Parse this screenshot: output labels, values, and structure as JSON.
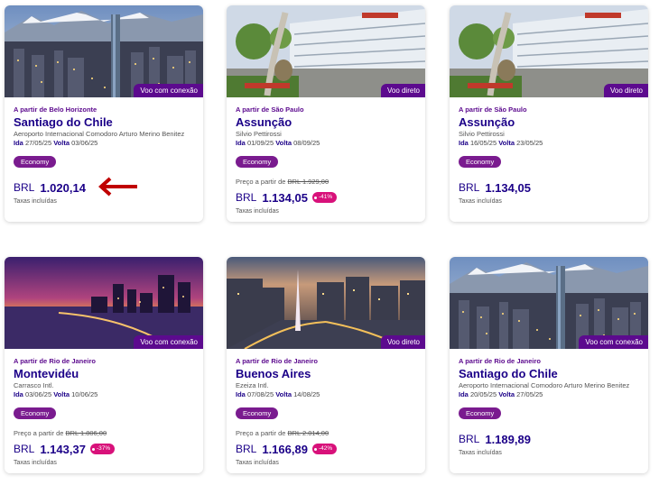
{
  "colors": {
    "primary": "#1b0088",
    "badge": "#5c0a8e",
    "fare": "#7a1b8f",
    "discount": "#d8117a",
    "arrow": "#c00000"
  },
  "labels": {
    "from_price": "Preço a partir de",
    "taxes": "Taxas incluídas",
    "ida": "Ida",
    "volta": "Volta",
    "currency": "BRL"
  },
  "cards": [
    {
      "image": "santiago-skyline",
      "badge": "Voo com conexão",
      "origin": "A partir de Belo Horizonte",
      "destination": "Santiago do Chile",
      "airport": "Aeroporto Internacional Comodoro Arturo Merino Benitez",
      "ida": "27/05/25",
      "volta": "03/06/25",
      "fare": "Economy",
      "old_price": "",
      "price": "1.020,14",
      "discount": ""
    },
    {
      "image": "asuncion-airport",
      "badge": "Voo direto",
      "origin": "A partir de São Paulo",
      "destination": "Assunção",
      "airport": "Silvio Pettirossi",
      "ida": "01/09/25",
      "volta": "08/09/25",
      "fare": "Economy",
      "old_price": "BRL 1.929,00",
      "price": "1.134,05",
      "discount": "-41%"
    },
    {
      "image": "asuncion-airport",
      "badge": "Voo direto",
      "origin": "A partir de São Paulo",
      "destination": "Assunção",
      "airport": "Silvio Pettirossi",
      "ida": "16/05/25",
      "volta": "23/05/25",
      "fare": "Economy",
      "old_price": "",
      "price": "1.134,05",
      "discount": ""
    },
    {
      "image": "montevideo-sunset",
      "badge": "Voo com conexão",
      "origin": "A partir de Rio de Janeiro",
      "destination": "Montevidéu",
      "airport": "Carrasco Intl.",
      "ida": "03/06/25",
      "volta": "10/06/25",
      "fare": "Economy",
      "old_price": "BRL 1.806,00",
      "price": "1.143,37",
      "discount": "-37%"
    },
    {
      "image": "buenos-aires-obelisk",
      "badge": "Voo direto",
      "origin": "A partir de Rio de Janeiro",
      "destination": "Buenos Aires",
      "airport": "Ezeiza Intl.",
      "ida": "07/08/25",
      "volta": "14/08/25",
      "fare": "Economy",
      "old_price": "BRL 2.014,00",
      "price": "1.166,89",
      "discount": "-42%"
    },
    {
      "image": "santiago-skyline",
      "badge": "Voo com conexão",
      "origin": "A partir de Rio de Janeiro",
      "destination": "Santiago do Chile",
      "airport": "Aeroporto Internacional Comodoro Arturo Merino Benitez",
      "ida": "20/05/25",
      "volta": "27/05/25",
      "fare": "Economy",
      "old_price": "",
      "price": "1.189,89",
      "discount": ""
    }
  ]
}
